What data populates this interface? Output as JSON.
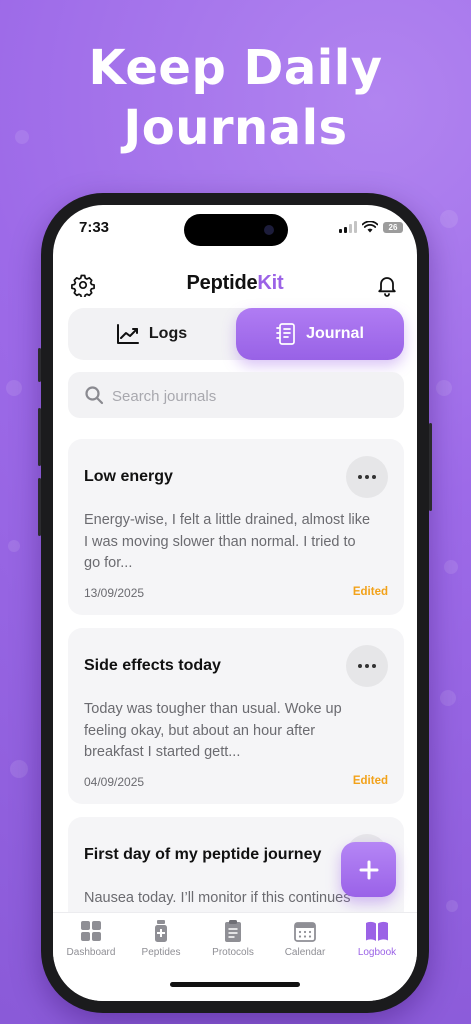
{
  "hero": {
    "title": "Keep Daily\nJournals"
  },
  "status_bar": {
    "time": "7:33",
    "battery": "26"
  },
  "header": {
    "brand_main": "Peptide",
    "brand_accent": "Kit"
  },
  "segments": [
    {
      "label": "Logs",
      "icon": "trend-chart-icon",
      "active": false
    },
    {
      "label": "Journal",
      "icon": "notebook-icon",
      "active": true
    }
  ],
  "search": {
    "placeholder": "Search journals",
    "value": ""
  },
  "entries": [
    {
      "title": "Low energy",
      "body": "Energy-wise, I felt a little drained, almost like I was moving slower than normal. I tried to go for...",
      "date": "13/09/2025",
      "status": "Edited"
    },
    {
      "title": "Side effects today",
      "body": "Today was tougher than usual. Woke up feeling okay, but about an hour after breakfast I started gett...",
      "date": "04/09/2025",
      "status": "Edited"
    },
    {
      "title": "First day of my peptide journey",
      "body": "Nausea today. I’ll monitor if this continues tomorrow. Hoping my body adjusts soon.",
      "date": "",
      "status": ""
    }
  ],
  "fab": {
    "icon": "plus-icon"
  },
  "tabs": [
    {
      "label": "Dashboard",
      "icon": "dashboard-grid-icon",
      "active": false
    },
    {
      "label": "Peptides",
      "icon": "vial-icon",
      "active": false
    },
    {
      "label": "Protocols",
      "icon": "clipboard-icon",
      "active": false
    },
    {
      "label": "Calendar",
      "icon": "calendar-icon",
      "active": false
    },
    {
      "label": "Logbook",
      "icon": "book-icon",
      "active": true
    }
  ],
  "colors": {
    "accent": "#9b62e6",
    "background": "#9d6ae8",
    "edited": "#f2a21a"
  }
}
